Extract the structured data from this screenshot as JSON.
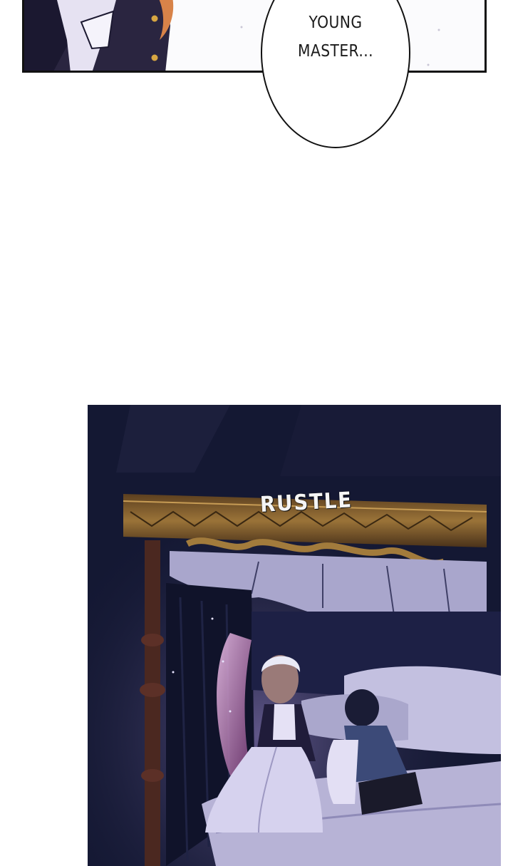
{
  "dialogue": {
    "line1": "YOUNG",
    "line2": "MASTER..."
  },
  "sound_effect": {
    "text": "RUSTLE"
  },
  "colors": {
    "panel_border": "#111111",
    "night_bg": "#141833",
    "bedding": "#b7b3d6",
    "maid_glow": "#e9b7e6",
    "canopy_gold": "#8a6430"
  }
}
